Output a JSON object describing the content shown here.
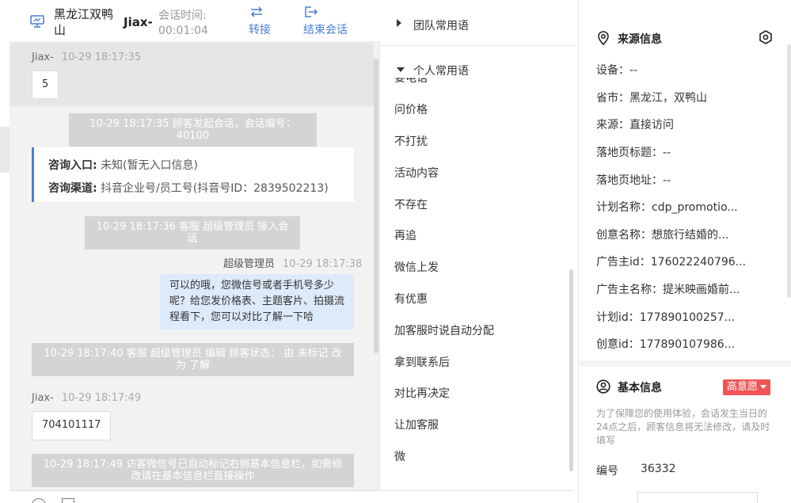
{
  "header": {
    "customer_name": "黑龙江双鸭山",
    "user_name": "Jiax-",
    "session_time_label": "会话时间:",
    "session_time_value": "00:01:04",
    "transfer_label": "转接",
    "end_label": "结束会话"
  },
  "chat": {
    "messages": [
      {
        "sender": "Jiax-",
        "time": "10-29 18:17:35",
        "text": "5"
      },
      {
        "text": "10-29 18:17:35 顾客发起会话，会话编号：40100"
      },
      {
        "entry_label": "咨询入口:",
        "entry_value": "未知(暂无入口信息)",
        "channel_label": "咨询渠道:",
        "channel_value": "抖音企业号/员工号(抖音号ID：2839502213)"
      },
      {
        "text": "10-29 18:17:36 客服 超级管理员 接入会话"
      },
      {
        "sender": "超级管理员",
        "time": "10-29 18:17:38",
        "text": "可以的哦，您微信号或者手机号多少呢？给您发价格表、主题客片、拍摄流程看下，您可以对比了解一下哈"
      },
      {
        "text": "10-29 18:17:40 客服 超级管理员 编辑 顾客状态： 由 未标记 改为 了解"
      },
      {
        "sender": "Jiax-",
        "time": "10-29 18:17:49",
        "text": "704101117"
      },
      {
        "text": "10-29 18:17:49 访客微信号已自动标记右侧基本信息栏，如需修改请在基本信息栏直接操作"
      }
    ]
  },
  "phrases": {
    "team_group": "团队常用语",
    "personal_group": "个人常用语",
    "partial_top": "要电话",
    "items": [
      "问价格",
      "不打扰",
      "活动内容",
      "不存在",
      "再追",
      "微信上发",
      "有优惠",
      "加客服时说自动分配",
      "拿到联系后",
      "对比再决定",
      "让加客服",
      "微"
    ]
  },
  "source_info": {
    "title": "来源信息",
    "rows": [
      "设备：--",
      "省市：黑龙江，双鸭山",
      "来源：直接访问",
      "落地页标题：--",
      "落地页地址：--",
      "计划名称：cdp_promotio...",
      "创意名称：想旅行结婚的...",
      "广告主id：176022240796...",
      "广告主名称：提米映画婚前...",
      "计划id：177890100257...",
      "创意id：177890107986..."
    ]
  },
  "basic_info": {
    "title": "基本信息",
    "intent_badge": "高意愿",
    "notice": "为了保障您的使用体验，会话发生当日的24点之后，顾客信息将无法修改，请及时填写",
    "id_label": "编号",
    "id_value": "36332"
  },
  "colors": {
    "accent": "#4a7fd1",
    "badge": "#f05454",
    "agent_bubble": "#ddeafa",
    "system_notice": "#d4d4d4"
  }
}
